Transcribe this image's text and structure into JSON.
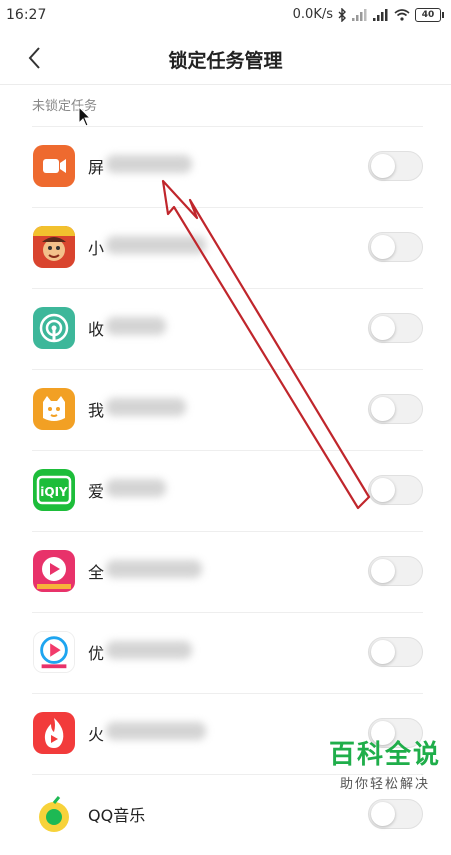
{
  "status_bar": {
    "time": "16:27",
    "net_speed": "0.0K/s",
    "battery": "40"
  },
  "header": {
    "title": "锁定任务管理",
    "back_icon": "chevron-left-icon"
  },
  "section": {
    "label": "未锁定任务"
  },
  "apps": [
    {
      "name": "屏",
      "icon": "video-camera-icon",
      "color": "#ee6a2f",
      "locked": false
    },
    {
      "name": "小",
      "icon": "game-character-icon",
      "color": "#d9442e",
      "locked": false
    },
    {
      "name": "收",
      "icon": "radio-broadcast-icon",
      "color": "#3db79a",
      "locked": false
    },
    {
      "name": "我",
      "icon": "cat-face-icon",
      "color": "#f2a024",
      "locked": false
    },
    {
      "name": "爱",
      "icon": "iqiyi-icon",
      "color": "#1dbd3a",
      "locked": false
    },
    {
      "name": "全",
      "icon": "play-heart-icon",
      "color": "#e8326a",
      "locked": false
    },
    {
      "name": "优",
      "icon": "youku-play-icon",
      "color": "#ffffff",
      "locked": false
    },
    {
      "name": "火",
      "icon": "flame-play-icon",
      "color": "#f23b3b",
      "locked": false
    },
    {
      "name": "QQ音乐",
      "icon": "qq-music-icon",
      "color": "#f7d23a",
      "locked": false
    }
  ],
  "iqiyi_text": "iQIY",
  "watermark": {
    "title": "百科全说",
    "subtitle": "助你轻松解决"
  },
  "colors": {
    "annotation_arrow": "#c0262c",
    "watermark_green": "#1fae4a"
  }
}
